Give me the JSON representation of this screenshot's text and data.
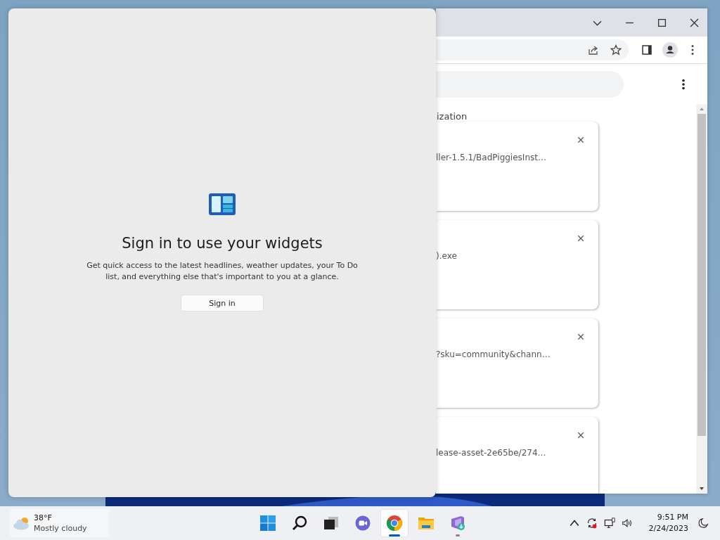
{
  "widgets": {
    "heading": "Sign in to use your widgets",
    "description": "Get quick access to the latest headlines, weather updates, your To Do list, and everything else that's important to you at a glance.",
    "button": "Sign in"
  },
  "browser": {
    "page_heading": "ization",
    "downloads": [
      {
        "text": "ller-1.5.1/BadPiggiesInst…"
      },
      {
        "text": ").exe"
      },
      {
        "text": "?sku=community&chann…"
      },
      {
        "text": "lease-asset-2e65be/274…"
      }
    ]
  },
  "taskbar": {
    "weather": {
      "temperature": "38°F",
      "condition": "Mostly cloudy"
    },
    "apps": [
      {
        "kind": "start",
        "active": false,
        "running": false
      },
      {
        "kind": "search",
        "active": false,
        "running": false
      },
      {
        "kind": "taskview",
        "active": false,
        "running": false
      },
      {
        "kind": "chat",
        "active": false,
        "running": false
      },
      {
        "kind": "chrome",
        "active": true,
        "running": true
      },
      {
        "kind": "explorer",
        "active": false,
        "running": false
      },
      {
        "kind": "installer",
        "active": false,
        "running": true
      }
    ],
    "clock": {
      "time": "9:51 PM",
      "date": "2/24/2023"
    }
  }
}
